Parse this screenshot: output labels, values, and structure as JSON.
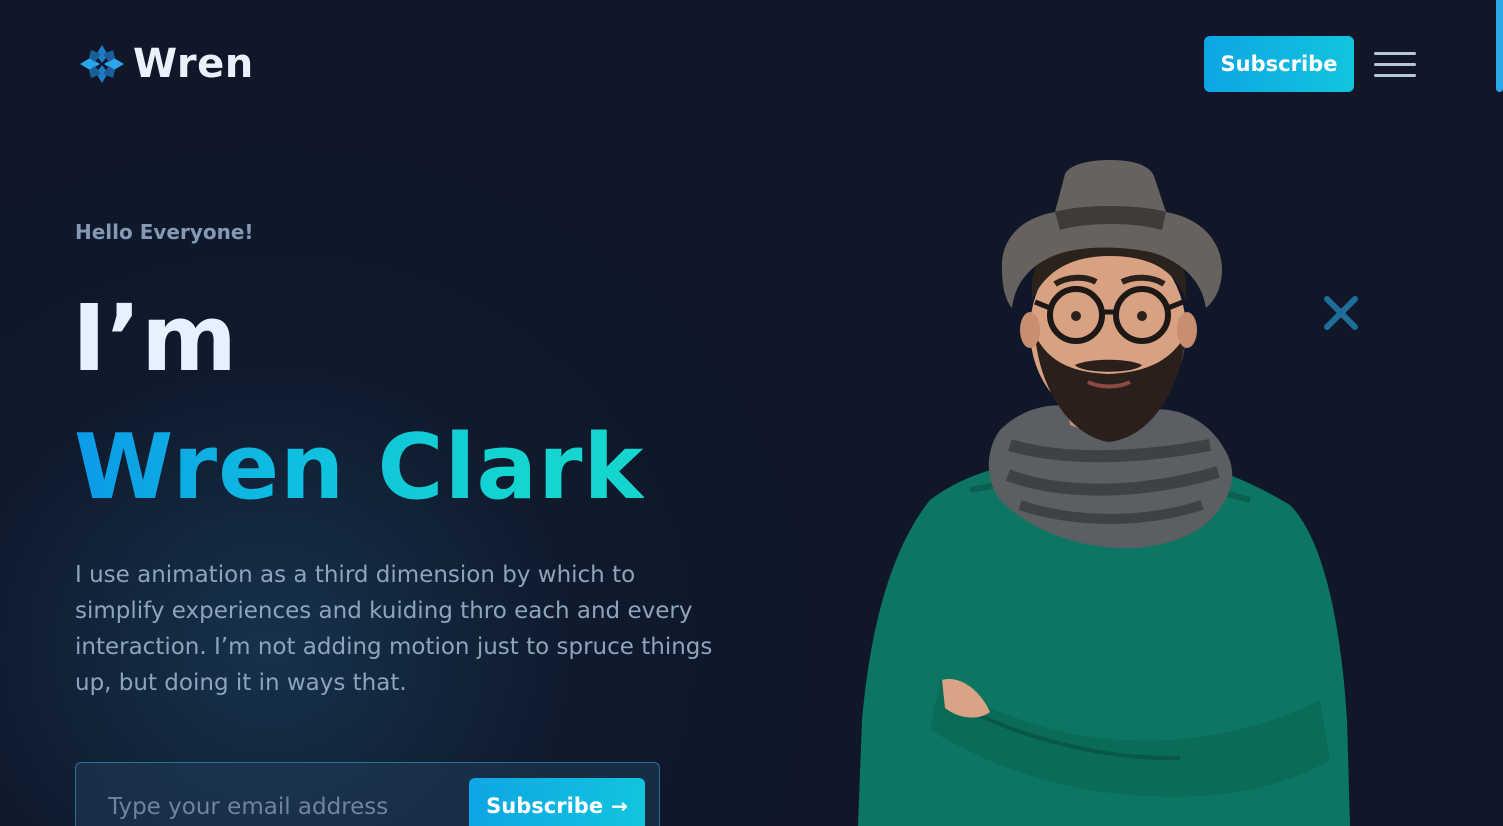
{
  "header": {
    "logo_text": "Wren",
    "subscribe_label": "Subscribe",
    "menu_icon": "hamburger-menu-icon"
  },
  "hero": {
    "greeting": "Hello Everyone!",
    "heading_prefix": "I’m",
    "name": "Wren Clark",
    "intro": "I use animation as a third dimension by which to simplify experiences and kuiding thro each and every interaction. I’m not adding motion just to spruce things up, but doing it in ways that.",
    "email": {
      "placeholder": "Type your email address",
      "value": "",
      "submit_label": "Subscribe",
      "submit_icon": "arrow-right-icon"
    },
    "decor_icon": "close-x-icon",
    "portrait": "bearded-man-with-hat-and-scarf-portrait"
  },
  "colors": {
    "background": "#0f1729",
    "header": "#111729",
    "accent_start": "#0ea5e4",
    "accent_end": "#11c5dd",
    "heading": "#e7f0ff",
    "muted_text": "#8ea3bc",
    "decor_x": "#1f6e9a"
  }
}
